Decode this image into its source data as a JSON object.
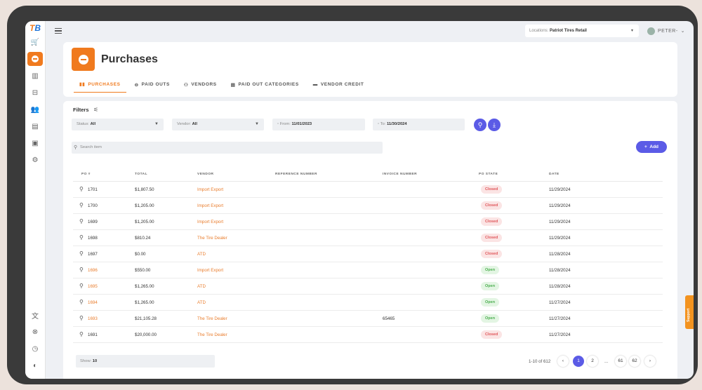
{
  "brand": {
    "logo_text": "TB",
    "accent": "#f07a1e",
    "primary": "#5b5be6"
  },
  "sidebar": {
    "items": [
      {
        "icon": "cart-icon",
        "glyph": "🛒"
      },
      {
        "icon": "purchases-icon",
        "glyph": "",
        "active": true
      },
      {
        "icon": "inventory-icon",
        "glyph": "▥"
      },
      {
        "icon": "tire-icon",
        "glyph": "⊟"
      },
      {
        "icon": "customers-icon",
        "glyph": "👥"
      },
      {
        "icon": "reports-icon",
        "glyph": "▤"
      },
      {
        "icon": "cash-register-icon",
        "glyph": "▣"
      },
      {
        "icon": "settings-icon",
        "glyph": "⚙"
      }
    ],
    "bottom_items": [
      {
        "icon": "translate-icon",
        "glyph": "文"
      },
      {
        "icon": "cancel-icon",
        "glyph": "⊗"
      },
      {
        "icon": "timer-icon",
        "glyph": "◷"
      },
      {
        "icon": "theme-icon",
        "glyph": "◐"
      }
    ]
  },
  "topbar": {
    "location_label": "Locations:",
    "location_value": "Patriot Tires Retail",
    "user_name": "PETER-"
  },
  "header": {
    "title": "Purchases",
    "tabs": [
      {
        "label": "PURCHASES",
        "icon": "purchases-tab-icon",
        "active": true
      },
      {
        "label": "PAID OUTS",
        "icon": "paid-outs-icon"
      },
      {
        "label": "VENDORS",
        "icon": "vendors-icon"
      },
      {
        "label": "PAID OUT CATEGORIES",
        "icon": "categories-icon"
      },
      {
        "label": "VENDOR CREDIT",
        "icon": "credit-card-icon"
      }
    ]
  },
  "filters": {
    "label": "Filters",
    "status_label": "Status:",
    "status_value": "All",
    "vendor_label": "Vendor:",
    "vendor_value": "All",
    "from_label": "From:",
    "from_value": "11/01/2023",
    "to_label": "To:",
    "to_value": "11/30/2024",
    "search_placeholder": "Search item",
    "add_label": "Add"
  },
  "table": {
    "columns": [
      "PO #",
      "TOTAL",
      "VENDOR",
      "REFERENCE NUMBER",
      "INVOICE NUMBER",
      "PO STATE",
      "DATE"
    ],
    "rows": [
      {
        "po": "1701",
        "po_link": false,
        "total": "$1,807.50",
        "vendor": "Import Export",
        "reference": "",
        "invoice": "",
        "state": "Closed",
        "date": "11/29/2024"
      },
      {
        "po": "1700",
        "po_link": false,
        "total": "$1,205.00",
        "vendor": "Import Export",
        "reference": "",
        "invoice": "",
        "state": "Closed",
        "date": "11/29/2024"
      },
      {
        "po": "1699",
        "po_link": false,
        "total": "$1,205.00",
        "vendor": "Import Export",
        "reference": "",
        "invoice": "",
        "state": "Closed",
        "date": "11/29/2024"
      },
      {
        "po": "1698",
        "po_link": false,
        "total": "$810.24",
        "vendor": "The Tire Dealer",
        "reference": "",
        "invoice": "",
        "state": "Closed",
        "date": "11/29/2024"
      },
      {
        "po": "1697",
        "po_link": false,
        "total": "$0.00",
        "vendor": "ATD",
        "reference": "",
        "invoice": "",
        "state": "Closed",
        "date": "11/28/2024"
      },
      {
        "po": "1696",
        "po_link": true,
        "total": "$550.00",
        "vendor": "Import Export",
        "reference": "",
        "invoice": "",
        "state": "Open",
        "date": "11/28/2024"
      },
      {
        "po": "1695",
        "po_link": true,
        "total": "$1,265.00",
        "vendor": "ATD",
        "reference": "",
        "invoice": "",
        "state": "Open",
        "date": "11/28/2024"
      },
      {
        "po": "1694",
        "po_link": true,
        "total": "$1,265.00",
        "vendor": "ATD",
        "reference": "",
        "invoice": "",
        "state": "Open",
        "date": "11/27/2024"
      },
      {
        "po": "1693",
        "po_link": true,
        "total": "$21,105.28",
        "vendor": "The Tire Dealer",
        "reference": "",
        "invoice": "65465",
        "state": "Open",
        "date": "11/27/2024"
      },
      {
        "po": "1691",
        "po_link": false,
        "total": "$20,000.00",
        "vendor": "The Tire Dealer",
        "reference": "",
        "invoice": "",
        "state": "Closed",
        "date": "11/27/2024"
      }
    ]
  },
  "pagination": {
    "show_label": "Show:",
    "show_value": "10",
    "range_text": "1-10 of 612",
    "pages": [
      "1",
      "2",
      "61",
      "62"
    ],
    "ellipsis": "...",
    "current": "1"
  },
  "support": {
    "label": "Support"
  }
}
